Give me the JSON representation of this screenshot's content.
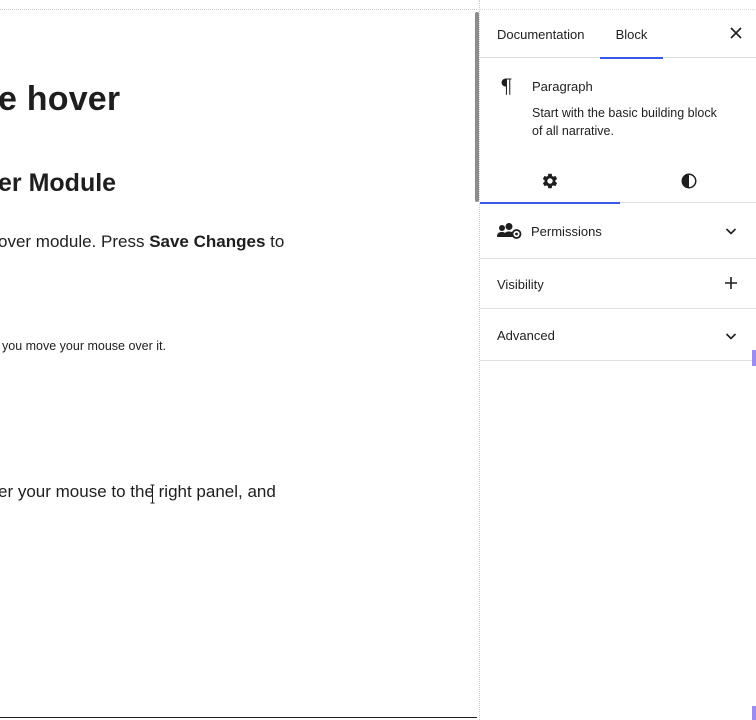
{
  "editor": {
    "heading1": "e hover",
    "heading2": "er Module",
    "paragraph1_prefix": "over module. Press ",
    "paragraph1_bold": "Save Changes",
    "paragraph1_suffix": " to",
    "small_text": "you move your mouse over it.",
    "paragraph2": "er your mouse to the right panel, and"
  },
  "sidebar": {
    "tabs": [
      {
        "label": "Documentation",
        "active": false
      },
      {
        "label": "Block",
        "active": true
      }
    ],
    "block": {
      "icon": "paragraph-icon",
      "title": "Paragraph",
      "description": "Start with the basic building block of all narrative."
    },
    "subtabs": [
      {
        "icon": "gear-icon",
        "active": true
      },
      {
        "icon": "contrast-icon",
        "active": false
      }
    ],
    "panels": [
      {
        "label": "Permissions",
        "icon": "users-icon",
        "control": "chevron-down-icon"
      },
      {
        "label": "Visibility",
        "control": "plus-icon"
      },
      {
        "label": "Advanced",
        "control": "chevron-down-icon"
      }
    ]
  },
  "colors": {
    "accent": "#3858e9",
    "text": "#1e1e1e",
    "border": "#e0e0e0"
  }
}
